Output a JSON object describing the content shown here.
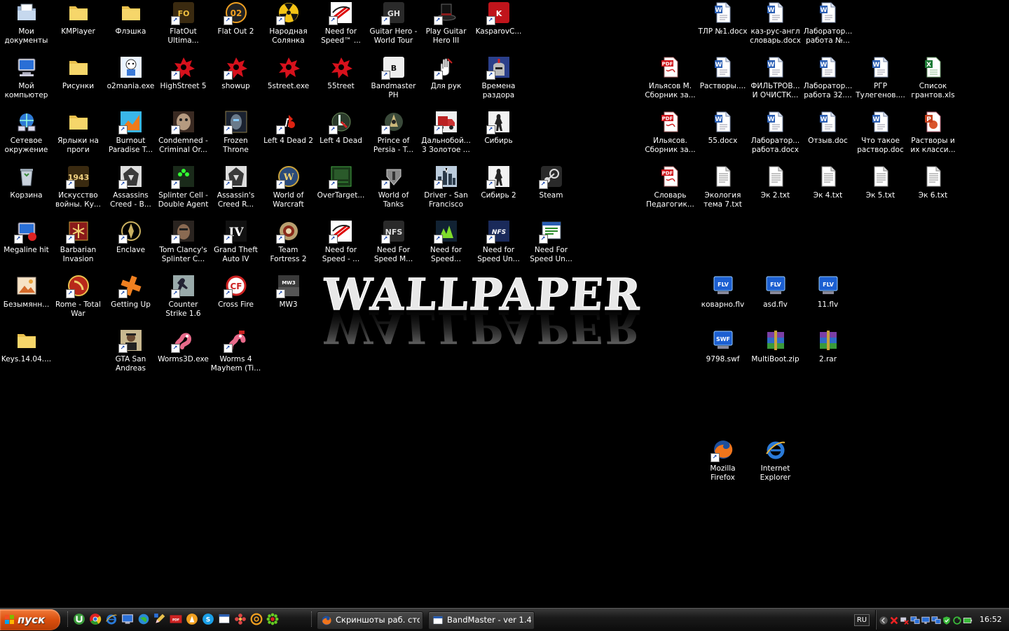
{
  "desktop": {
    "wallpaper_text": "WALLPAPER",
    "icons": [
      {
        "label": "Мои документы",
        "icon": "my-documents-icon",
        "shortcut": false
      },
      {
        "label": "KMPlayer",
        "icon": "folder-icon",
        "shortcut": false
      },
      {
        "label": "Флэшка",
        "icon": "folder-icon",
        "shortcut": false
      },
      {
        "label": "FlatOut Ultima...",
        "icon": "flatout-icon",
        "shortcut": true
      },
      {
        "label": "Flat Out 2",
        "icon": "flatout2-icon",
        "shortcut": true
      },
      {
        "label": "Народная Солянка 20...",
        "icon": "radiation-icon",
        "shortcut": true
      },
      {
        "label": "Need for Speed™ ...",
        "icon": "nfs-icon",
        "shortcut": true
      },
      {
        "label": "Guitar Hero - World Tour",
        "icon": "guitar-hero-icon",
        "shortcut": true
      },
      {
        "label": "Play Guitar Hero III",
        "icon": "top-hat-icon",
        "shortcut": true
      },
      {
        "label": "KasparovC...",
        "icon": "chess-icon",
        "shortcut": true
      },
      {
        "label": "Мой компьютер",
        "icon": "my-computer-icon",
        "shortcut": false
      },
      {
        "label": "Рисунки",
        "icon": "folder-icon",
        "shortcut": false
      },
      {
        "label": "o2mania.exe",
        "icon": "o2mania-icon",
        "shortcut": false
      },
      {
        "label": "HighStreet 5",
        "icon": "red-splash-icon",
        "shortcut": true
      },
      {
        "label": "showup",
        "icon": "red-splash-icon",
        "shortcut": true
      },
      {
        "label": "5street.exe",
        "icon": "red-splash-icon",
        "shortcut": false
      },
      {
        "label": "55treet",
        "icon": "red-splash-icon",
        "shortcut": false
      },
      {
        "label": "Bandmaster PH",
        "icon": "bandmaster-icon",
        "shortcut": true
      },
      {
        "label": "Для рук",
        "icon": "hand-icon",
        "shortcut": true
      },
      {
        "label": "Времена раздора",
        "icon": "knight-icon",
        "shortcut": true
      },
      {
        "label": "Сетевое окружение",
        "icon": "network-icon",
        "shortcut": false
      },
      {
        "label": "Ярлыки на проги",
        "icon": "folder-icon",
        "shortcut": false
      },
      {
        "label": "Burnout Paradise T...",
        "icon": "burnout-icon",
        "shortcut": true
      },
      {
        "label": "Condemned - Criminal Or...",
        "icon": "face-icon",
        "shortcut": true
      },
      {
        "label": "Frozen Throne",
        "icon": "frozen-throne-icon",
        "shortcut": true
      },
      {
        "label": "Left 4 Dead 2",
        "icon": "l4d2-icon",
        "shortcut": true
      },
      {
        "label": "Left 4 Dead",
        "icon": "l4d-icon",
        "shortcut": true
      },
      {
        "label": "Prince of Persia - T...",
        "icon": "prince-icon",
        "shortcut": true
      },
      {
        "label": "Дальнобой... 3 Золотое ...",
        "icon": "truck-icon",
        "shortcut": true
      },
      {
        "label": "Сибирь",
        "icon": "sibir-icon",
        "shortcut": true
      },
      {
        "label": "Корзина",
        "icon": "recycle-bin-icon",
        "shortcut": false
      },
      {
        "label": "Искусство войны. Ку...",
        "icon": "1943-icon",
        "shortcut": true
      },
      {
        "label": "Assassins Creed - B...",
        "icon": "assassin-icon",
        "shortcut": true
      },
      {
        "label": "Splinter Cell - Double Agent",
        "icon": "splinter-icon",
        "shortcut": true
      },
      {
        "label": "Assassin's Creed R...",
        "icon": "assassin-icon",
        "shortcut": true
      },
      {
        "label": "World of Warcraft",
        "icon": "wow-icon",
        "shortcut": true
      },
      {
        "label": "OverTarget...",
        "icon": "overtarget-icon",
        "shortcut": true
      },
      {
        "label": "World of Tanks",
        "icon": "tanks-icon",
        "shortcut": true
      },
      {
        "label": "Driver - San Francisco",
        "icon": "driver-icon",
        "shortcut": true
      },
      {
        "label": "Сибирь 2",
        "icon": "sibir2-icon",
        "shortcut": true
      },
      {
        "label": "Steam",
        "icon": "steam-icon",
        "shortcut": true
      },
      {
        "label": "Megaline hit",
        "icon": "megaline-icon",
        "shortcut": true
      },
      {
        "label": "Barbarian Invasion",
        "icon": "barbarian-icon",
        "shortcut": true
      },
      {
        "label": "Enclave",
        "icon": "enclave-icon",
        "shortcut": true
      },
      {
        "label": "Tom Clancy's Splinter C...",
        "icon": "splinter-face-icon",
        "shortcut": true
      },
      {
        "label": "Grand Theft Auto IV",
        "icon": "gta4-icon",
        "shortcut": true
      },
      {
        "label": "Team Fortress 2",
        "icon": "tf2-icon",
        "shortcut": true
      },
      {
        "label": "Need for Speed - ...",
        "icon": "nfs-icon",
        "shortcut": true
      },
      {
        "label": "Need For Speed M...",
        "icon": "nfsmw-icon",
        "shortcut": true
      },
      {
        "label": "Need for Speed...",
        "icon": "nfs-green-icon",
        "shortcut": true
      },
      {
        "label": "Need for Speed Un...",
        "icon": "nfs-underground-icon",
        "shortcut": true
      },
      {
        "label": "Need For Speed Un...",
        "icon": "window-doc-icon",
        "shortcut": true
      },
      {
        "label": "Безымянн...",
        "icon": "image-icon",
        "shortcut": false
      },
      {
        "label": "Rome - Total War",
        "icon": "rome-icon",
        "shortcut": true
      },
      {
        "label": "Getting Up",
        "icon": "getting-up-icon",
        "shortcut": true
      },
      {
        "label": "Counter Strike 1.6",
        "icon": "cs-icon",
        "shortcut": true
      },
      {
        "label": "Cross Fire",
        "icon": "crossfire-icon",
        "shortcut": true
      },
      {
        "label": "MW3",
        "icon": "mw3-icon",
        "shortcut": true
      },
      {
        "label": "Keys.14.04....",
        "icon": "folder-icon",
        "shortcut": false
      },
      {
        "label": "GTA San Andreas",
        "icon": "gtasa-icon",
        "shortcut": true
      },
      {
        "label": "Worms3D.exe",
        "icon": "worms-icon",
        "shortcut": true
      },
      {
        "label": "Worms 4 Mayhem (Ti...",
        "icon": "worms4-icon",
        "shortcut": true
      },
      {
        "label": "ТЛР №1.docx",
        "icon": "word-doc-icon",
        "shortcut": false
      },
      {
        "label": "каз-рус-англ словарь.docx",
        "icon": "word-doc-icon",
        "shortcut": false
      },
      {
        "label": "Лаборатор... работа №...",
        "icon": "word-doc-icon",
        "shortcut": false
      },
      {
        "label": "Ильясов М. Сборник за...",
        "icon": "pdf-icon",
        "shortcut": false
      },
      {
        "label": "Растворы....",
        "icon": "word-doc-icon",
        "shortcut": false
      },
      {
        "label": "ФИЛЬТРОВ... И ОЧИСТК...",
        "icon": "word-doc-icon",
        "shortcut": false
      },
      {
        "label": "Лаборатор... работа 32....",
        "icon": "word-doc-icon",
        "shortcut": false
      },
      {
        "label": "РГР Тулегенов....",
        "icon": "word-doc-icon",
        "shortcut": false
      },
      {
        "label": "Список грантов.xls",
        "icon": "excel-icon",
        "shortcut": false
      },
      {
        "label": "Ильясов. Сборник за...",
        "icon": "pdf-icon",
        "shortcut": false
      },
      {
        "label": "55.docx",
        "icon": "word-doc-icon",
        "shortcut": false
      },
      {
        "label": "Лаборатор... работа.docx",
        "icon": "word-doc-icon",
        "shortcut": false
      },
      {
        "label": "Отзыв.doc",
        "icon": "word-doc-icon",
        "shortcut": false
      },
      {
        "label": "Что такое раствор.doc",
        "icon": "word-doc-icon",
        "shortcut": false
      },
      {
        "label": "Растворы и их класси...",
        "icon": "ppt-icon",
        "shortcut": false
      },
      {
        "label": "Словарь Педагогик...",
        "icon": "pdf-icon",
        "shortcut": false
      },
      {
        "label": "Экология тема 7.txt",
        "icon": "text-file-icon",
        "shortcut": false
      },
      {
        "label": "Эк 2.txt",
        "icon": "text-file-icon",
        "shortcut": false
      },
      {
        "label": "Эк 4.txt",
        "icon": "text-file-icon",
        "shortcut": false
      },
      {
        "label": "Эк 5.txt",
        "icon": "text-file-icon",
        "shortcut": false
      },
      {
        "label": "Эк 6.txt",
        "icon": "text-file-icon",
        "shortcut": false
      },
      {
        "label": "коварно.flv",
        "icon": "flv-icon",
        "shortcut": false
      },
      {
        "label": "asd.flv",
        "icon": "flv-icon",
        "shortcut": false
      },
      {
        "label": "11.flv",
        "icon": "flv-icon",
        "shortcut": false
      },
      {
        "label": "9798.swf",
        "icon": "swf-icon",
        "shortcut": false
      },
      {
        "label": "MultiBoot.zip",
        "icon": "winrar-icon",
        "shortcut": false
      },
      {
        "label": "2.rar",
        "icon": "winrar-icon",
        "shortcut": false
      },
      {
        "label": "Mozilla Firefox",
        "icon": "firefox-icon",
        "shortcut": true
      },
      {
        "label": "Internet Explorer",
        "icon": "ie-icon",
        "shortcut": false
      }
    ]
  },
  "taskbar": {
    "start_label": "пуск",
    "quick_launch": [
      "utorrent-icon",
      "chrome-icon",
      "ie-icon",
      "desktop-icon",
      "globe-icon",
      "pencil-icon",
      "abbyy-icon",
      "aimp-icon",
      "skype-icon",
      "window-icon",
      "flower-icon",
      "mail-icon",
      "icq-icon"
    ],
    "tasks": [
      {
        "label": "Скриншоты раб. сто...",
        "icon": "firefox-icon"
      },
      {
        "label": "BandMaster - ver 1.4....",
        "icon": "window-icon"
      }
    ],
    "tray": {
      "language": "RU",
      "icons": [
        "arrow-left-icon",
        "red-x-icon",
        "network-x-icon",
        "network-icon",
        "monitor-icon",
        "pc-icon",
        "green-shield-icon",
        "refresh-icon",
        "battery-icon"
      ],
      "clock": "16:52"
    }
  }
}
